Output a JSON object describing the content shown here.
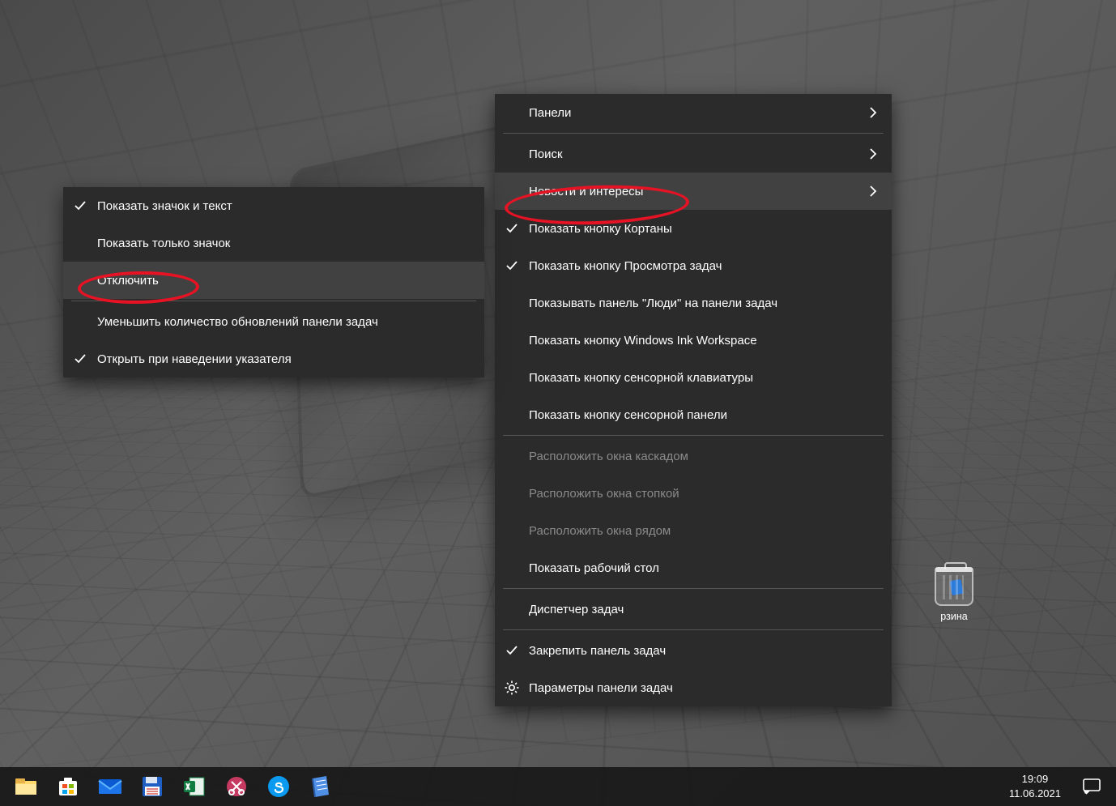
{
  "desktop": {
    "recycle_bin_label": "рзина"
  },
  "submenu": {
    "items": [
      {
        "label": "Показать значок и текст",
        "checked": true
      },
      {
        "label": "Показать только значок",
        "checked": false
      },
      {
        "label": "Отключить",
        "checked": false,
        "highlighted": true
      }
    ],
    "after_sep": [
      {
        "label": "Уменьшить количество обновлений панели задач",
        "checked": false
      },
      {
        "label": "Открыть при наведении указателя",
        "checked": true
      }
    ]
  },
  "mainmenu": {
    "group1": [
      {
        "label": "Панели",
        "submenu": true
      },
      {
        "label": "Поиск",
        "submenu": true
      },
      {
        "label": "Новости и интересы",
        "submenu": true,
        "hovered": true,
        "highlighted": true
      },
      {
        "label": "Показать кнопку Кортаны",
        "checked": true
      },
      {
        "label": "Показать кнопку Просмотра задач",
        "checked": true
      },
      {
        "label": "Показывать панель \"Люди\" на панели задач"
      },
      {
        "label": "Показать кнопку Windows Ink Workspace"
      },
      {
        "label": "Показать кнопку сенсорной клавиатуры"
      },
      {
        "label": "Показать кнопку сенсорной панели"
      }
    ],
    "group2": [
      {
        "label": "Расположить окна каскадом",
        "disabled": true
      },
      {
        "label": "Расположить окна стопкой",
        "disabled": true
      },
      {
        "label": "Расположить окна рядом",
        "disabled": true
      },
      {
        "label": "Показать рабочий стол"
      }
    ],
    "group3": [
      {
        "label": "Диспетчер задач"
      }
    ],
    "group4": [
      {
        "label": "Закрепить панель задач",
        "checked": true
      },
      {
        "label": "Параметры панели задач",
        "icon": "gear"
      }
    ]
  },
  "taskbar": {
    "icons": [
      "file-explorer",
      "microsoft-store",
      "mail",
      "notepad-save",
      "excel",
      "snip-tool",
      "skype",
      "folder-docs"
    ],
    "clock_time": "19:09",
    "clock_date": "11.06.2021"
  }
}
